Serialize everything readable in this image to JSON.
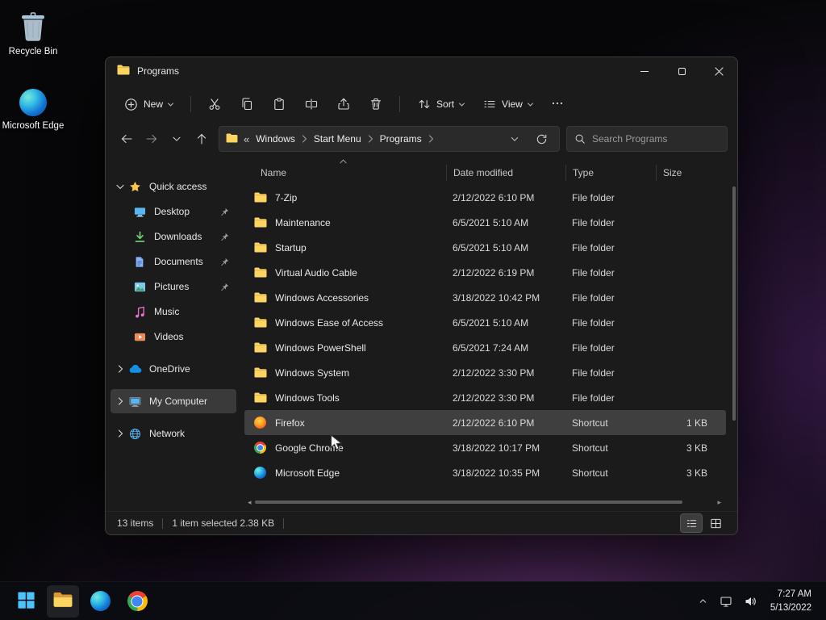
{
  "colors": {
    "accent": "#4cc2ff",
    "folder_yellow": "#fcd462",
    "selection": "#3f3f3f",
    "taskbar": "#0b0d11"
  },
  "desktop": {
    "icons": [
      {
        "label": "Recycle Bin",
        "icon": "recycle-bin"
      },
      {
        "label": "Microsoft Edge",
        "icon": "edge"
      }
    ]
  },
  "window": {
    "title": "Programs",
    "toolbar": {
      "new_label": "New",
      "actions": [
        "cut",
        "copy",
        "paste",
        "rename",
        "share",
        "delete"
      ],
      "sort_label": "Sort",
      "view_label": "View"
    },
    "address": {
      "overflow_glyph": "«",
      "crumbs": [
        "Windows",
        "Start Menu",
        "Programs"
      ],
      "search_placeholder": "Search Programs"
    },
    "sidebar": {
      "sections": [
        {
          "label": "Quick access",
          "icon": "star",
          "expanded": true,
          "selected": false,
          "children": [
            {
              "label": "Desktop",
              "icon": "desktop",
              "pinned": true
            },
            {
              "label": "Downloads",
              "icon": "downloads",
              "pinned": true
            },
            {
              "label": "Documents",
              "icon": "documents",
              "pinned": true
            },
            {
              "label": "Pictures",
              "icon": "pictures",
              "pinned": true
            },
            {
              "label": "Music",
              "icon": "music",
              "pinned": false
            },
            {
              "label": "Videos",
              "icon": "videos",
              "pinned": false
            }
          ]
        },
        {
          "label": "OneDrive",
          "icon": "onedrive",
          "expanded": false,
          "selected": false,
          "children": []
        },
        {
          "label": "My Computer",
          "icon": "computer",
          "expanded": false,
          "selected": true,
          "children": []
        },
        {
          "label": "Network",
          "icon": "network",
          "expanded": false,
          "selected": false,
          "children": []
        }
      ]
    },
    "list": {
      "columns": [
        "Name",
        "Date modified",
        "Type",
        "Size"
      ],
      "sort_column": "Name",
      "sort_ascending": true,
      "rows": [
        {
          "name": "7-Zip",
          "date": "2/12/2022 6:10 PM",
          "type": "File folder",
          "size": "",
          "icon": "folder",
          "selected": false
        },
        {
          "name": "Maintenance",
          "date": "6/5/2021 5:10 AM",
          "type": "File folder",
          "size": "",
          "icon": "folder",
          "selected": false
        },
        {
          "name": "Startup",
          "date": "6/5/2021 5:10 AM",
          "type": "File folder",
          "size": "",
          "icon": "folder",
          "selected": false
        },
        {
          "name": "Virtual Audio Cable",
          "date": "2/12/2022 6:19 PM",
          "type": "File folder",
          "size": "",
          "icon": "folder",
          "selected": false
        },
        {
          "name": "Windows Accessories",
          "date": "3/18/2022 10:42 PM",
          "type": "File folder",
          "size": "",
          "icon": "folder",
          "selected": false
        },
        {
          "name": "Windows Ease of Access",
          "date": "6/5/2021 5:10 AM",
          "type": "File folder",
          "size": "",
          "icon": "folder",
          "selected": false
        },
        {
          "name": "Windows PowerShell",
          "date": "6/5/2021 7:24 AM",
          "type": "File folder",
          "size": "",
          "icon": "folder",
          "selected": false
        },
        {
          "name": "Windows System",
          "date": "2/12/2022 3:30 PM",
          "type": "File folder",
          "size": "",
          "icon": "folder",
          "selected": false
        },
        {
          "name": "Windows Tools",
          "date": "2/12/2022 3:30 PM",
          "type": "File folder",
          "size": "",
          "icon": "folder",
          "selected": false
        },
        {
          "name": "Firefox",
          "date": "2/12/2022 6:10 PM",
          "type": "Shortcut",
          "size": "1 KB",
          "icon": "firefox",
          "selected": true
        },
        {
          "name": "Google Chrome",
          "date": "3/18/2022 10:17 PM",
          "type": "Shortcut",
          "size": "3 KB",
          "icon": "chrome",
          "selected": false
        },
        {
          "name": "Microsoft Edge",
          "date": "3/18/2022 10:35 PM",
          "type": "Shortcut",
          "size": "3 KB",
          "icon": "edge",
          "selected": false
        }
      ]
    },
    "statusbar": {
      "items_count": "13 items",
      "selection": "1 item selected 2.38 KB"
    }
  },
  "taskbar": {
    "apps": [
      "start",
      "explorer",
      "edge",
      "chrome"
    ],
    "active_app": "explorer",
    "time": "7:27 AM",
    "date": "5/13/2022"
  }
}
